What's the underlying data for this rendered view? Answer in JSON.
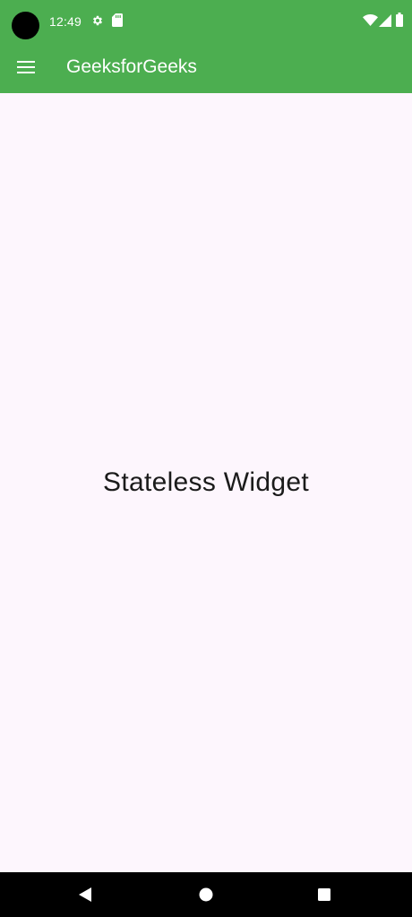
{
  "status_bar": {
    "time": "12:49",
    "left_icons": [
      "settings-gear-icon",
      "sd-card-icon"
    ],
    "right_icons": [
      "wifi-icon",
      "cell-signal-icon",
      "battery-icon"
    ],
    "background_color": "#4cae50"
  },
  "app_bar": {
    "title": "GeeksforGeeks",
    "menu_icon": "hamburger-menu-icon",
    "background_color": "#4cae50",
    "text_color": "#ffffff"
  },
  "content": {
    "center_text": "Stateless Widget",
    "background_color": "#fdf6fd"
  },
  "nav_bar": {
    "buttons": [
      "back-triangle-icon",
      "home-circle-icon",
      "recents-square-icon"
    ],
    "background_color": "#000000"
  }
}
